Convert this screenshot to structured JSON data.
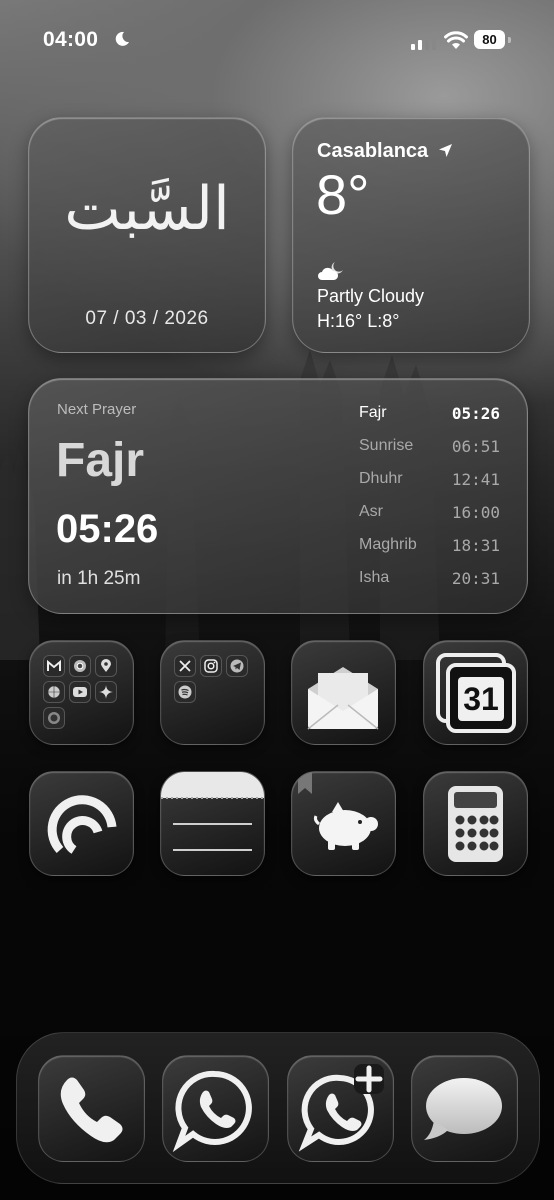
{
  "status_bar": {
    "time": "04:00",
    "focus_icon": "moon-icon",
    "signal_icon": "cellular-signal-icon",
    "wifi_icon": "wifi-icon",
    "battery": "80"
  },
  "date_widget": {
    "arabic_day": "السَّبت",
    "date": "07 / 03 / 2026"
  },
  "weather_widget": {
    "city": "Casablanca",
    "location_icon": "location-arrow-icon",
    "temperature": "8°",
    "condition_icon": "partly-cloudy-night-icon",
    "condition": "Partly Cloudy",
    "high_low": "H:16° L:8°"
  },
  "prayer_widget": {
    "label": "Next Prayer",
    "next_name": "Fajr",
    "next_time": "05:26",
    "countdown": "in 1h 25m",
    "times": [
      {
        "name": "Fajr",
        "time": "05:26",
        "active": true
      },
      {
        "name": "Sunrise",
        "time": "06:51",
        "active": false
      },
      {
        "name": "Dhuhr",
        "time": "12:41",
        "active": false
      },
      {
        "name": "Asr",
        "time": "16:00",
        "active": false
      },
      {
        "name": "Maghrib",
        "time": "18:31",
        "active": false
      },
      {
        "name": "Isha",
        "time": "20:31",
        "active": false
      }
    ]
  },
  "apps_row1": [
    {
      "name": "folder-google",
      "icons": [
        "gmail-icon",
        "chrome-icon",
        "maps-icon",
        "photos-icon",
        "youtube-icon",
        "gemini-icon",
        "camera-icon"
      ]
    },
    {
      "name": "folder-social",
      "icons": [
        "x-icon",
        "instagram-icon",
        "telegram-icon",
        "spotify-icon"
      ]
    },
    {
      "name": "mail-app",
      "icon": "envelope-icon"
    },
    {
      "name": "calendar-app",
      "icon": "calendar-icon",
      "day": "31"
    }
  ],
  "apps_row2": [
    {
      "name": "podcast-app",
      "icon": "podcast-icon"
    },
    {
      "name": "notes-app",
      "icon": "notes-icon"
    },
    {
      "name": "savings-app",
      "icon": "piggy-bank-icon"
    },
    {
      "name": "calculator-app",
      "icon": "calculator-icon"
    }
  ],
  "dock": [
    "phone-icon",
    "whatsapp-icon",
    "whatsapp-business-icon",
    "messages-icon"
  ]
}
